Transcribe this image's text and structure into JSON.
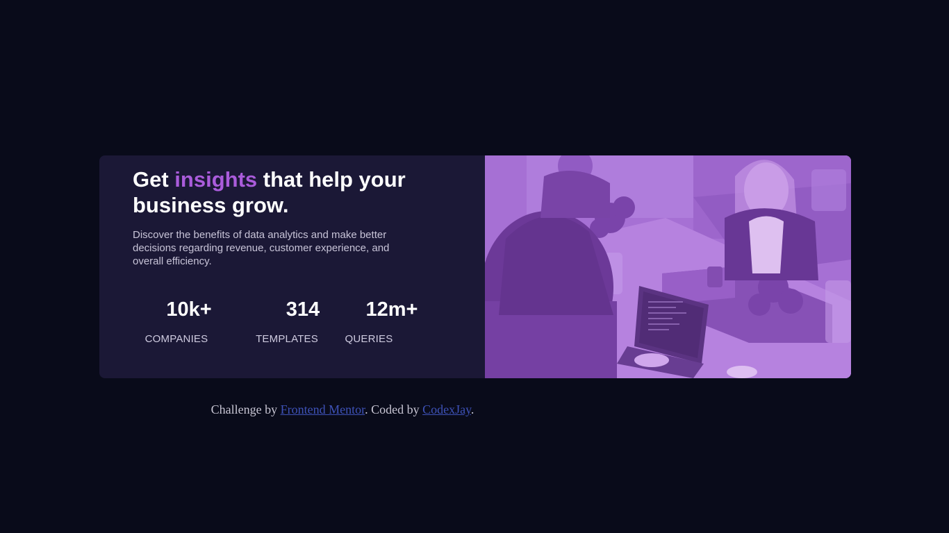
{
  "card": {
    "headline": {
      "part1": "Get ",
      "accent": "insights",
      "part2": " that help your business grow."
    },
    "description": "Discover the benefits of data analytics and make better decisions regarding revenue, customer experience, and overall efficiency.",
    "stats": [
      {
        "value": "10k+",
        "label": "COMPANIES"
      },
      {
        "value": "314",
        "label": "TEMPLATES"
      },
      {
        "value": "12m+",
        "label": "QUERIES"
      }
    ],
    "image_overlay_color": "#aa5cdb"
  },
  "attribution": {
    "prefix": "Challenge by ",
    "link1": "Frontend Mentor",
    "middle": ". Coded by ",
    "link2": "CodexJay",
    "suffix": "."
  },
  "colors": {
    "page_background": "#090b1a",
    "card_background": "#1b1836",
    "accent": "#aa5cdb",
    "link": "#3e52b8"
  }
}
